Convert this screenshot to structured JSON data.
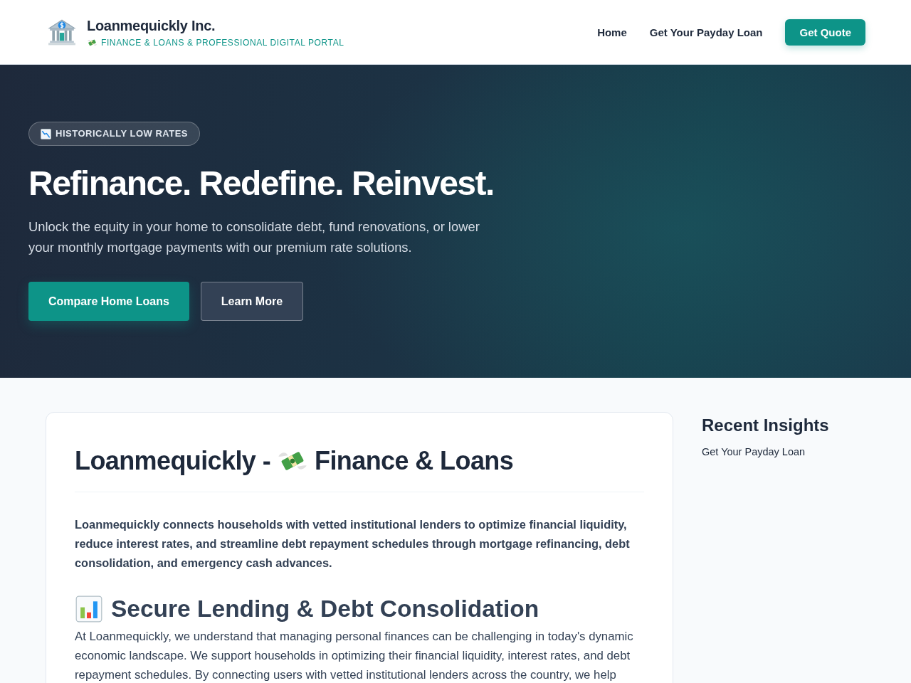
{
  "header": {
    "brand_name": "Loanmequickly Inc.",
    "tagline": "FINANCE & LOANS & PROFESSIONAL DIGITAL PORTAL",
    "nav": [
      "Home",
      "Get Your Payday Loan"
    ],
    "cta_button": "Get Quote"
  },
  "hero": {
    "badge": "HISTORICALLY LOW RATES",
    "title": "Refinance. Redefine. Reinvest.",
    "text": "Unlock the equity in your home to consolidate debt, fund renovations, or lower your monthly mortgage payments with our premium rate solutions.",
    "buttons": [
      {
        "label": "Compare Home Loans",
        "kind": "primary"
      },
      {
        "label": "Learn More",
        "kind": "secondary"
      }
    ]
  },
  "article": {
    "title_parts": [
      "Loanmequickly -",
      "Finance & Loans"
    ],
    "lead": "Loanmequickly connects households with vetted institutional lenders to optimize financial liquidity, reduce interest rates, and streamline debt repayment schedules through mortgage refinancing, debt consolidation, and emergency cash advances.",
    "sections": [
      {
        "heading": "Secure Lending & Debt Consolidation",
        "text": "At Loanmequickly, we understand that managing personal finances can be challenging in today's dynamic economic landscape. We support households in optimizing their financial liquidity, interest rates, and debt repayment schedules. By connecting users with vetted institutional lenders across the country, we help"
      }
    ]
  },
  "sidebar": {
    "title": "Recent Insights",
    "links": [
      "Get Your Payday Loan"
    ]
  }
}
